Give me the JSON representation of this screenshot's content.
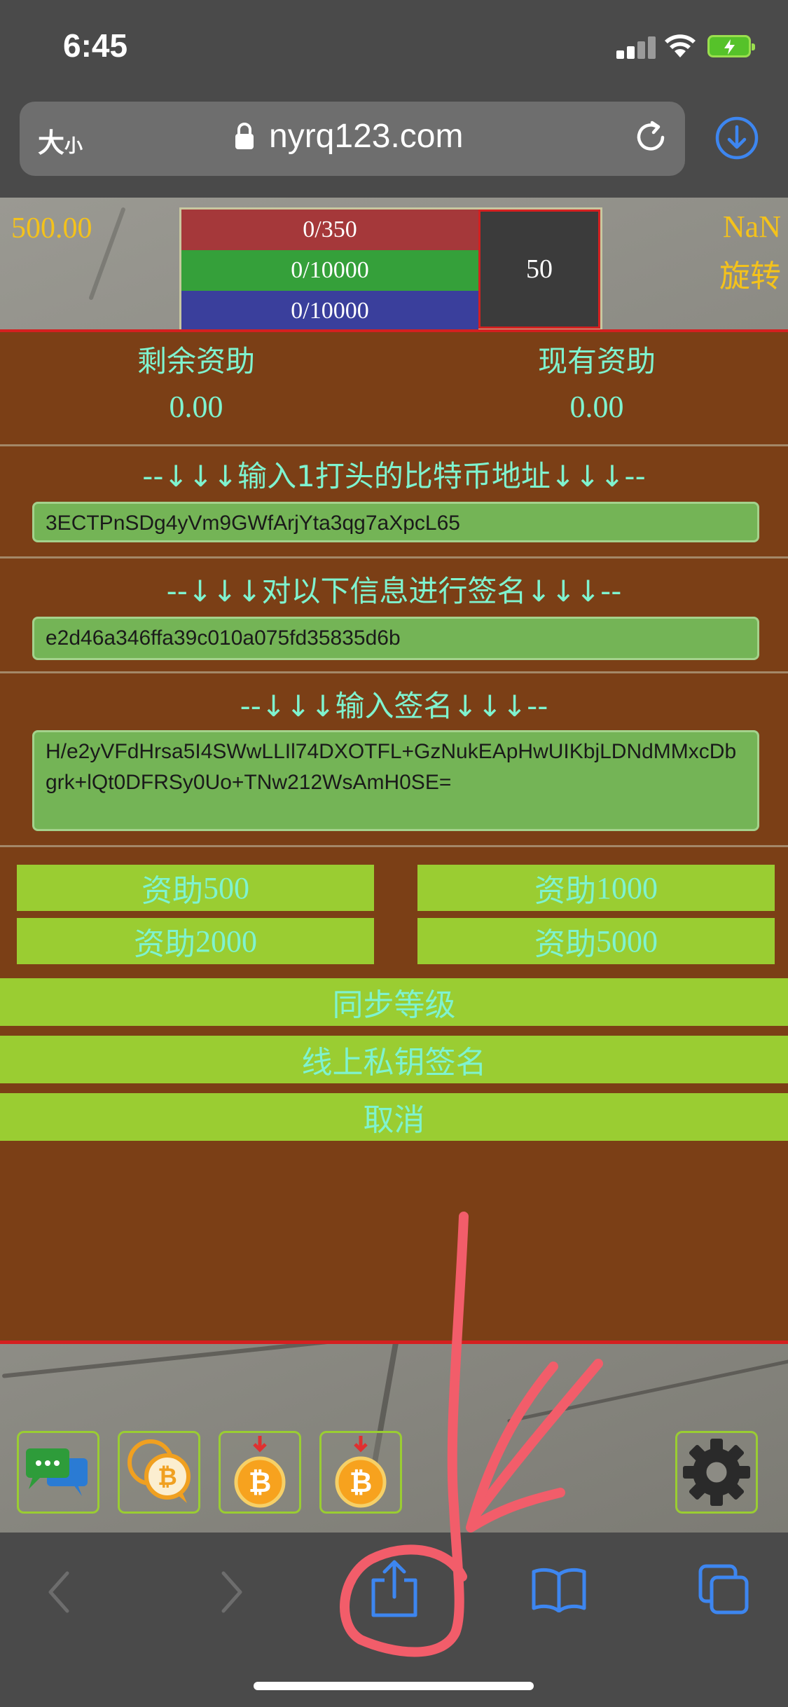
{
  "status_bar": {
    "time": "6:45"
  },
  "browser": {
    "text_size_label": "大",
    "text_size_small": "小",
    "url": "nyrq123.com"
  },
  "header": {
    "money": "500.00",
    "nan": "NaN",
    "rotate": "旋转",
    "bars": {
      "red": "0/350",
      "green": "0/10000",
      "blue": "0/10000"
    },
    "level": "50"
  },
  "funds": {
    "remaining_label": "剩余资助",
    "remaining_value": "0.00",
    "current_label": "现有资助",
    "current_value": "0.00"
  },
  "address_section": {
    "title": "--↓↓↓输入1打头的比特币地址↓↓↓--",
    "value": "3ECTPnSDg4yVm9GWfArjYta3qg7aXpcL65"
  },
  "message_section": {
    "title": "--↓↓↓对以下信息进行签名↓↓↓--",
    "value": "e2d46a346ffa39c010a075fd35835d6b"
  },
  "signature_section": {
    "title": "--↓↓↓输入签名↓↓↓--",
    "value": "H/e2yVFdHrsa5I4SWwLLIl74DXOTFL+GzNukEApHwUIKbjLDNdMMxcDbgrk+lQt0DFRSy0Uo+TNw212WsAmH0SE="
  },
  "buttons": {
    "fund_500_prefix": "资助",
    "fund_500_num": "500",
    "fund_1000_prefix": "资助",
    "fund_1000_num": "1000",
    "fund_2000_prefix": "资助",
    "fund_2000_num": "2000",
    "fund_5000_prefix": "资助",
    "fund_5000_num": "5000",
    "sync_level": "同步等级",
    "online_sign": "线上私钥签名",
    "cancel": "取消"
  },
  "bottom_icons": [
    "chat-icon",
    "bitcoin-chat-icon",
    "bitcoin-download-icon",
    "bitcoin-download-icon",
    "gear-icon"
  ],
  "colors": {
    "panel": "#7b3f16",
    "accent_text": "#7ff3cf",
    "button": "#9acd32",
    "gold": "#f4c21b",
    "border_red": "#d42020"
  }
}
